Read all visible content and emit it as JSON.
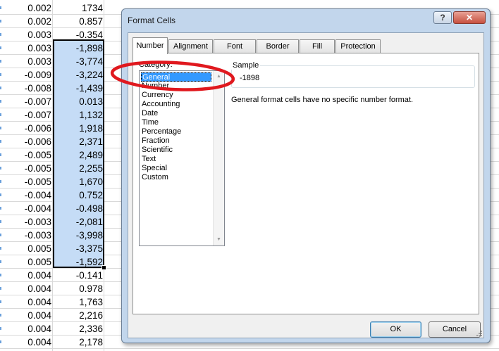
{
  "sheet": {
    "colA": [
      "0.002",
      "0.002",
      "0.003",
      "0.003",
      "0.003",
      "-0.009",
      "-0.008",
      "-0.007",
      "-0.007",
      "-0.006",
      "-0.006",
      "-0.005",
      "-0.005",
      "-0.005",
      "-0.004",
      "-0.004",
      "-0.003",
      "-0.003",
      "0.005",
      "0.005",
      "0.004",
      "0.004",
      "0.004",
      "0.004",
      "0.004",
      "0.004"
    ],
    "colB": [
      "1734",
      "0.857",
      "-0.354",
      "-1,898",
      "-3,774",
      "-3,224",
      "-1,439",
      "0.013",
      "1,132",
      "1,918",
      "2,371",
      "2,489",
      "2,255",
      "1,670",
      "0.752",
      "-0.498",
      "-2,081",
      "-3,998",
      "-3,375",
      "-1,592",
      "-0.141",
      "0.978",
      "1,763",
      "2,216",
      "2,336",
      "2,178"
    ]
  },
  "dialog": {
    "title": "Format Cells",
    "help_label": "?",
    "close_label": "✕",
    "tabs": [
      "Number",
      "Alignment",
      "Font",
      "Border",
      "Fill",
      "Protection"
    ],
    "active_tab": "Number",
    "category_label": "Category:",
    "categories": [
      "General",
      "Number",
      "Currency",
      "Accounting",
      "Date",
      "Time",
      "Percentage",
      "Fraction",
      "Scientific",
      "Text",
      "Special",
      "Custom"
    ],
    "selected_category": "General",
    "sample_label": "Sample",
    "sample_value": "-1898",
    "description": "General format cells have no specific number format.",
    "ok_label": "OK",
    "cancel_label": "Cancel"
  },
  "colors": {
    "selection_fill": "#c5dcf6",
    "annotation": "#e0181e",
    "list_highlight": "#3399ff"
  }
}
